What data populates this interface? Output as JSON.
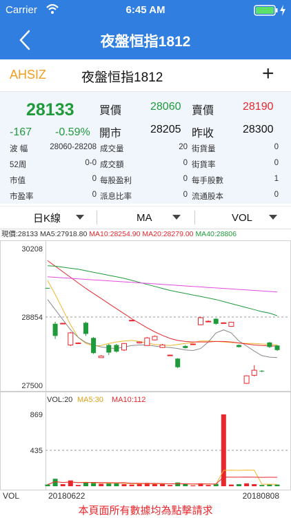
{
  "status": {
    "carrier": "Carrier",
    "time": "6:45 AM"
  },
  "nav": {
    "title": "夜盤恒指1812"
  },
  "symbol": {
    "code": "AHSIZ",
    "name": "夜盤恒指1812",
    "add": "+"
  },
  "quote": {
    "price": "28133",
    "change": "-167",
    "change_pct": "-0.59%",
    "bid_label": "買價",
    "bid": "28060",
    "ask_label": "賣價",
    "ask": "28190",
    "open_label": "開市",
    "open": "28205",
    "prev_label": "昨收",
    "prev": "28300",
    "rows": [
      {
        "l1": "波 幅",
        "v1": "28060-28208",
        "l2": "成交量",
        "v2": "20",
        "l3": "街貨量",
        "v3": "0"
      },
      {
        "l1": "52周",
        "v1": "0-0",
        "l2": "成交額",
        "v2": "0",
        "l3": "街貨率",
        "v3": "0"
      },
      {
        "l1": "市值",
        "v1": "0",
        "l2": "每股盈利",
        "v2": "0",
        "l3": "每手股數",
        "v3": "1"
      },
      {
        "l1": "市盈率",
        "v1": "0",
        "l2": "派息比率",
        "v2": "0",
        "l3": "流通股本",
        "v3": "0"
      }
    ]
  },
  "selectors": {
    "period": "日K線",
    "indicator": "MA",
    "sub": "VOL"
  },
  "ma_bar": {
    "now": "現價:28133",
    "ma5": "MA5:27918.80",
    "ma10": "MA10:28254.90",
    "ma20": "MA20:28279.00",
    "ma40": "MA40:28806"
  },
  "chart_data": {
    "type": "candlestick",
    "price_axis": {
      "top": "30208",
      "mid": "28854",
      "bottom": "27500"
    },
    "vol_axis": {
      "top": "869",
      "mid": "435"
    },
    "vol_legend": {
      "vol": "VOL:20",
      "ma5": "MA5:30",
      "ma10": "MA10:112"
    },
    "x_labels": {
      "start": "20180622",
      "end": "20180808",
      "axis": "VOL"
    },
    "candles": [
      {
        "o": 29430,
        "c": 29420,
        "h": 29430,
        "l": 29420,
        "v": 20
      },
      {
        "o": 28720,
        "c": 28480,
        "h": 28760,
        "l": 28420,
        "v": 90
      },
      {
        "o": 28730,
        "c": 28730,
        "h": 28740,
        "l": 28720,
        "v": 25
      },
      {
        "o": 28300,
        "c": 28540,
        "h": 28560,
        "l": 28280,
        "v": 70
      },
      {
        "o": 28340,
        "c": 28340,
        "h": 28350,
        "l": 28330,
        "v": 15
      },
      {
        "o": 28740,
        "c": 28520,
        "h": 28760,
        "l": 28480,
        "v": 45
      },
      {
        "o": 28440,
        "c": 28140,
        "h": 28460,
        "l": 28120,
        "v": 50
      },
      {
        "o": 28050,
        "c": 28080,
        "h": 28100,
        "l": 28040,
        "v": 30
      },
      {
        "o": 28300,
        "c": 28150,
        "h": 28320,
        "l": 28100,
        "v": 40
      },
      {
        "o": 28300,
        "c": 28170,
        "h": 28320,
        "l": 28150,
        "v": 35
      },
      {
        "o": 28200,
        "c": 28330,
        "h": 28340,
        "l": 28180,
        "v": 25
      },
      {
        "o": 28790,
        "c": 28790,
        "h": 28800,
        "l": 28780,
        "v": 20
      },
      {
        "o": 28340,
        "c": 28360,
        "h": 28370,
        "l": 28330,
        "v": 30
      },
      {
        "o": 28290,
        "c": 28440,
        "h": 28460,
        "l": 28280,
        "v": 40
      },
      {
        "o": 28400,
        "c": 28470,
        "h": 28490,
        "l": 28390,
        "v": 30
      },
      {
        "o": 28250,
        "c": 28300,
        "h": 28320,
        "l": 28240,
        "v": 25
      },
      {
        "o": 28100,
        "c": 28100,
        "h": 28110,
        "l": 28090,
        "v": 15
      },
      {
        "o": 28030,
        "c": 27860,
        "h": 28040,
        "l": 27840,
        "v": 45
      },
      {
        "o": 28280,
        "c": 28240,
        "h": 28300,
        "l": 28230,
        "v": 30
      },
      {
        "o": 28320,
        "c": 28320,
        "h": 28330,
        "l": 28310,
        "v": 10
      },
      {
        "o": 28700,
        "c": 28840,
        "h": 28860,
        "l": 28690,
        "v": 35
      },
      {
        "o": 28770,
        "c": 28770,
        "h": 28790,
        "l": 28750,
        "v": 15
      },
      {
        "o": 28820,
        "c": 28720,
        "h": 28830,
        "l": 28700,
        "v": 30
      },
      {
        "o": 28740,
        "c": 28740,
        "h": 28750,
        "l": 28730,
        "v": 869
      },
      {
        "o": 28670,
        "c": 28750,
        "h": 28760,
        "l": 28660,
        "v": 20
      },
      {
        "o": 28300,
        "c": 28260,
        "h": 28310,
        "l": 28250,
        "v": 25
      },
      {
        "o": 27540,
        "c": 27690,
        "h": 27700,
        "l": 27530,
        "v": 35
      },
      {
        "o": 27700,
        "c": 27800,
        "h": 27900,
        "l": 27680,
        "v": 25
      },
      {
        "o": 27790,
        "c": 27780,
        "h": 27800,
        "l": 27760,
        "v": 15
      },
      {
        "o": 28350,
        "c": 28260,
        "h": 28360,
        "l": 28240,
        "v": 20
      },
      {
        "o": 28290,
        "c": 28200,
        "h": 28300,
        "l": 28180,
        "v": 20
      }
    ],
    "ma_lines": [
      {
        "name": "MA5",
        "color": "#f1b52a",
        "values": [
          29580,
          29300,
          29000,
          28700,
          28450,
          28330,
          28280,
          28290,
          28330,
          28360,
          28380,
          28390,
          28370,
          28340,
          28310,
          28300,
          28290,
          28310,
          28330,
          28350,
          28380,
          28380,
          28370,
          28360,
          28350,
          28340,
          28330,
          28330,
          28320,
          28310,
          28300
        ]
      },
      {
        "name": "MA10",
        "color": "#888888",
        "values": [
          29200,
          29000,
          28800,
          28600,
          28450,
          28350,
          28300,
          28260,
          28240,
          28230,
          28260,
          28290,
          28300,
          28300,
          28280,
          28260,
          28250,
          28230,
          28200,
          28190,
          28230,
          28360,
          28540,
          28600,
          28540,
          28380,
          28280,
          28180,
          28090,
          28060,
          28050
        ]
      },
      {
        "name": "MA20",
        "color": "#e8262c",
        "values": [
          29970,
          29860,
          29750,
          29640,
          29530,
          29420,
          29320,
          29220,
          29120,
          29020,
          28920,
          28820,
          28730,
          28640,
          28560,
          28490,
          28430,
          28390,
          28370,
          28360,
          28360,
          28360,
          28370,
          28370,
          28360,
          28340,
          28320,
          28300,
          28290,
          28280,
          28280
        ]
      },
      {
        "name": "MA40",
        "color": "#1f9a3a",
        "values": [
          29870,
          29860,
          29840,
          29820,
          29800,
          29770,
          29740,
          29710,
          29680,
          29650,
          29620,
          29580,
          29540,
          29500,
          29460,
          29420,
          29380,
          29350,
          29320,
          29290,
          29260,
          29230,
          29200,
          29160,
          29120,
          29080,
          29040,
          29000,
          28960,
          28930,
          28880
        ]
      },
      {
        "name": "MA60",
        "color": "#e34be0",
        "values": [
          29650,
          29640,
          29630,
          29620,
          29610,
          29600,
          29590,
          29580,
          29570,
          29560,
          29550,
          29540,
          29530,
          29520,
          29510,
          29500,
          29490,
          29480,
          29470,
          29460,
          29450,
          29440,
          29430,
          29420,
          29410,
          29400,
          29390,
          29380,
          29370,
          29360,
          29350
        ]
      }
    ]
  }
}
